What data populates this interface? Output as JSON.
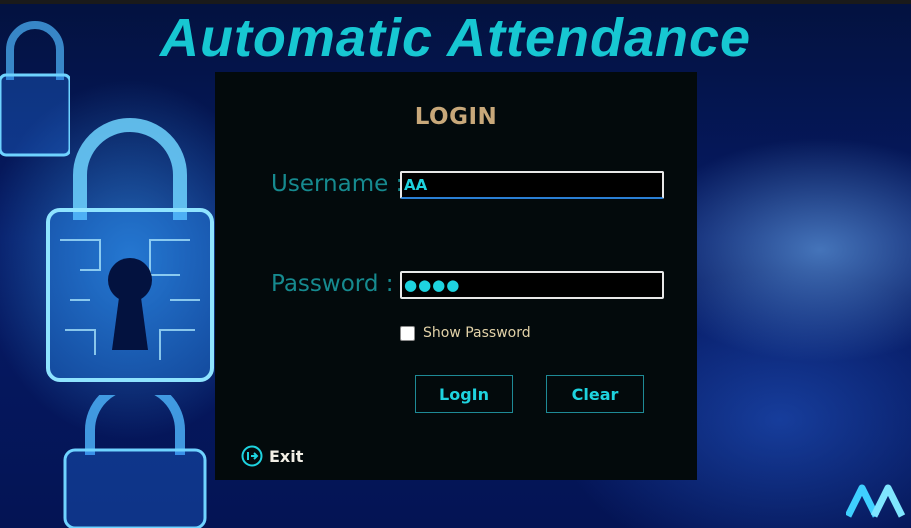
{
  "app": {
    "title": "Automatic Attendance"
  },
  "login_form": {
    "heading": "LOGIN",
    "username_label": "Username :",
    "username_value": "AA",
    "password_label": "Password  :",
    "password_value": "●●●●",
    "show_password_label": "Show Password",
    "show_password_checked": false,
    "login_button": "LogIn",
    "clear_button": "Clear",
    "exit_label": "Exit"
  },
  "colors": {
    "accent": "#1ed3df",
    "title": "#17c7d2",
    "heading": "#c8a87a",
    "label": "#168a8f",
    "panel": "#030a0c"
  },
  "icons": {
    "exit": "exit-arrow-icon",
    "background_lock": "padlock-icon",
    "brand": "brand-logo-icon"
  }
}
